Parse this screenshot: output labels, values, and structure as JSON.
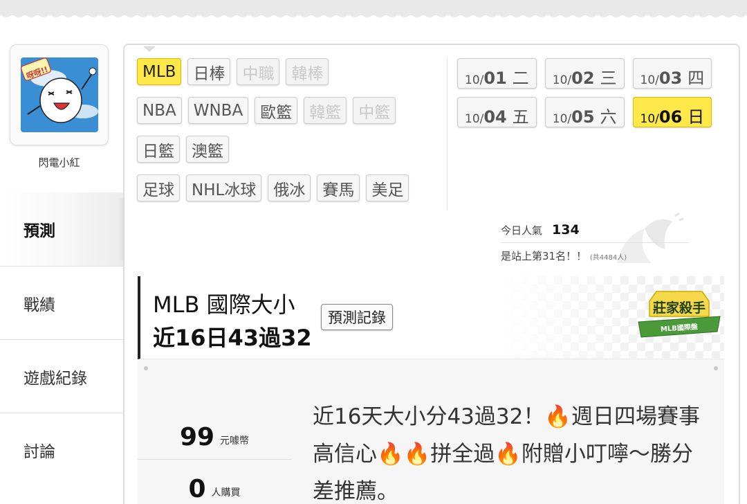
{
  "user": {
    "name": "閃電小紅",
    "avatar_caption": "呀呀!!"
  },
  "nav": {
    "items": [
      {
        "label": "預測",
        "active": true
      },
      {
        "label": "戰績",
        "active": false
      },
      {
        "label": "遊戲紀錄",
        "active": false
      },
      {
        "label": "討論",
        "active": false
      }
    ]
  },
  "leagues": {
    "rows": [
      [
        {
          "label": "MLB",
          "state": "active"
        },
        {
          "label": "日棒",
          "state": "normal"
        },
        {
          "label": "中職",
          "state": "disabled"
        },
        {
          "label": "韓棒",
          "state": "disabled"
        }
      ],
      [
        {
          "label": "NBA",
          "state": "normal"
        },
        {
          "label": "WNBA",
          "state": "normal"
        },
        {
          "label": "歐籃",
          "state": "normal"
        },
        {
          "label": "韓籃",
          "state": "disabled"
        },
        {
          "label": "中籃",
          "state": "disabled"
        }
      ],
      [
        {
          "label": "日籃",
          "state": "normal"
        },
        {
          "label": "澳籃",
          "state": "normal"
        }
      ],
      [
        {
          "label": "足球",
          "state": "normal"
        },
        {
          "label": "NHL冰球",
          "state": "normal"
        },
        {
          "label": "俄冰",
          "state": "normal"
        },
        {
          "label": "賽馬",
          "state": "normal"
        },
        {
          "label": "美足",
          "state": "normal"
        }
      ]
    ]
  },
  "dates": {
    "rows": [
      [
        {
          "month": "10/",
          "day": "01",
          "weekday": "二",
          "active": false
        },
        {
          "month": "10/",
          "day": "02",
          "weekday": "三",
          "active": false
        },
        {
          "month": "10/",
          "day": "03",
          "weekday": "四",
          "active": false
        }
      ],
      [
        {
          "month": "10/",
          "day": "04",
          "weekday": "五",
          "active": false
        },
        {
          "month": "10/",
          "day": "05",
          "weekday": "六",
          "active": false
        },
        {
          "month": "10/",
          "day": "06",
          "weekday": "日",
          "active": true
        }
      ]
    ]
  },
  "popularity": {
    "label": "今日人氣",
    "value": "134",
    "rank_text": "是站上第31名！！",
    "total_text": "(共4484人)"
  },
  "prediction": {
    "title_line1": "MLB 國際大小",
    "title_line2": "近16日43過32",
    "record_button": "預測記錄",
    "badge_title": "莊家殺手",
    "badge_sub": "MLB國際盤",
    "price_value": "99",
    "price_unit": "元噱幣",
    "buyers_value": "0",
    "buyers_unit": "人購買",
    "desc_parts": [
      "近16天大小分43過32！",
      "週日四場賽事高信心",
      "拼全過",
      "附贈小叮嚀～勝分差推薦。"
    ]
  },
  "colors": {
    "accent_yellow": "#ffe84a",
    "fire": "#e8561d"
  }
}
